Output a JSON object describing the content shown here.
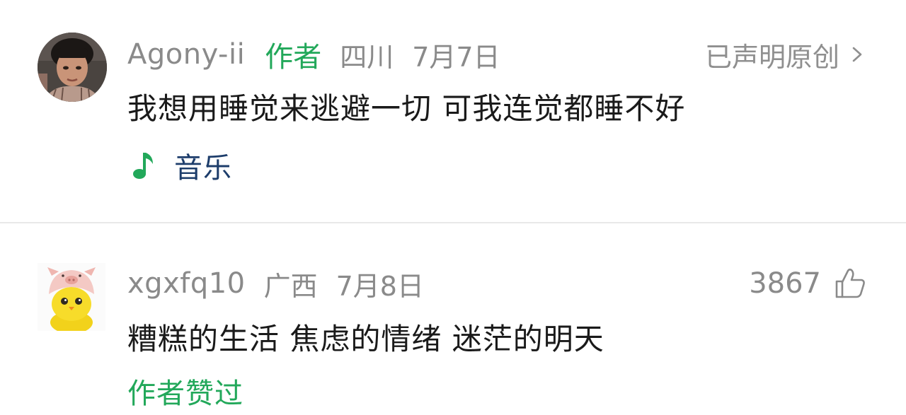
{
  "comments": [
    {
      "username": "Agony-ii",
      "author_tag": "作者",
      "location": "四川",
      "date": "7月7日",
      "declared_original": "已声明原创",
      "text": "我想用睡觉来逃避一切 可我连觉都睡不好",
      "music": {
        "icon": "music-note-icon",
        "label": "音乐"
      },
      "avatar": "avatar-photo-man"
    },
    {
      "username": "xgxfq10",
      "location": "广西",
      "date": "7月8日",
      "likes": "3867",
      "text": "糟糕的生活 焦虑的情绪 迷茫的明天",
      "author_liked": "作者赞过",
      "avatar": "avatar-yellow-chick-pig-hat"
    }
  ],
  "colors": {
    "author_green": "#22a85a",
    "meta_gray": "#8a8a8a",
    "music_blue": "#1d3d6b",
    "text": "#1a1a1a",
    "divider": "#e8e8e8"
  }
}
